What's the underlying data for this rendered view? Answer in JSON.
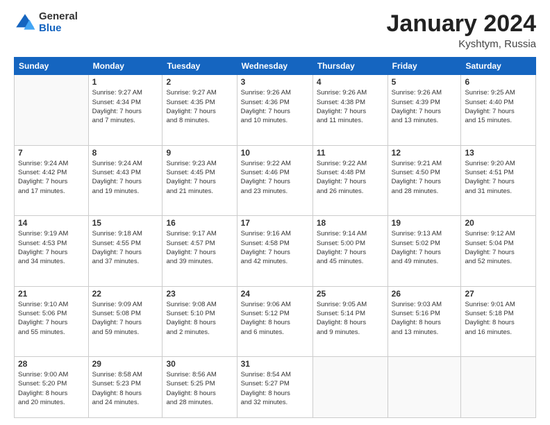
{
  "header": {
    "logo_general": "General",
    "logo_blue": "Blue",
    "title": "January 2024",
    "location": "Kyshtym, Russia"
  },
  "weekdays": [
    "Sunday",
    "Monday",
    "Tuesday",
    "Wednesday",
    "Thursday",
    "Friday",
    "Saturday"
  ],
  "weeks": [
    [
      {
        "day": "",
        "info": ""
      },
      {
        "day": "1",
        "info": "Sunrise: 9:27 AM\nSunset: 4:34 PM\nDaylight: 7 hours\nand 7 minutes."
      },
      {
        "day": "2",
        "info": "Sunrise: 9:27 AM\nSunset: 4:35 PM\nDaylight: 7 hours\nand 8 minutes."
      },
      {
        "day": "3",
        "info": "Sunrise: 9:26 AM\nSunset: 4:36 PM\nDaylight: 7 hours\nand 10 minutes."
      },
      {
        "day": "4",
        "info": "Sunrise: 9:26 AM\nSunset: 4:38 PM\nDaylight: 7 hours\nand 11 minutes."
      },
      {
        "day": "5",
        "info": "Sunrise: 9:26 AM\nSunset: 4:39 PM\nDaylight: 7 hours\nand 13 minutes."
      },
      {
        "day": "6",
        "info": "Sunrise: 9:25 AM\nSunset: 4:40 PM\nDaylight: 7 hours\nand 15 minutes."
      }
    ],
    [
      {
        "day": "7",
        "info": "Sunrise: 9:24 AM\nSunset: 4:42 PM\nDaylight: 7 hours\nand 17 minutes."
      },
      {
        "day": "8",
        "info": "Sunrise: 9:24 AM\nSunset: 4:43 PM\nDaylight: 7 hours\nand 19 minutes."
      },
      {
        "day": "9",
        "info": "Sunrise: 9:23 AM\nSunset: 4:45 PM\nDaylight: 7 hours\nand 21 minutes."
      },
      {
        "day": "10",
        "info": "Sunrise: 9:22 AM\nSunset: 4:46 PM\nDaylight: 7 hours\nand 23 minutes."
      },
      {
        "day": "11",
        "info": "Sunrise: 9:22 AM\nSunset: 4:48 PM\nDaylight: 7 hours\nand 26 minutes."
      },
      {
        "day": "12",
        "info": "Sunrise: 9:21 AM\nSunset: 4:50 PM\nDaylight: 7 hours\nand 28 minutes."
      },
      {
        "day": "13",
        "info": "Sunrise: 9:20 AM\nSunset: 4:51 PM\nDaylight: 7 hours\nand 31 minutes."
      }
    ],
    [
      {
        "day": "14",
        "info": "Sunrise: 9:19 AM\nSunset: 4:53 PM\nDaylight: 7 hours\nand 34 minutes."
      },
      {
        "day": "15",
        "info": "Sunrise: 9:18 AM\nSunset: 4:55 PM\nDaylight: 7 hours\nand 37 minutes."
      },
      {
        "day": "16",
        "info": "Sunrise: 9:17 AM\nSunset: 4:57 PM\nDaylight: 7 hours\nand 39 minutes."
      },
      {
        "day": "17",
        "info": "Sunrise: 9:16 AM\nSunset: 4:58 PM\nDaylight: 7 hours\nand 42 minutes."
      },
      {
        "day": "18",
        "info": "Sunrise: 9:14 AM\nSunset: 5:00 PM\nDaylight: 7 hours\nand 45 minutes."
      },
      {
        "day": "19",
        "info": "Sunrise: 9:13 AM\nSunset: 5:02 PM\nDaylight: 7 hours\nand 49 minutes."
      },
      {
        "day": "20",
        "info": "Sunrise: 9:12 AM\nSunset: 5:04 PM\nDaylight: 7 hours\nand 52 minutes."
      }
    ],
    [
      {
        "day": "21",
        "info": "Sunrise: 9:10 AM\nSunset: 5:06 PM\nDaylight: 7 hours\nand 55 minutes."
      },
      {
        "day": "22",
        "info": "Sunrise: 9:09 AM\nSunset: 5:08 PM\nDaylight: 7 hours\nand 59 minutes."
      },
      {
        "day": "23",
        "info": "Sunrise: 9:08 AM\nSunset: 5:10 PM\nDaylight: 8 hours\nand 2 minutes."
      },
      {
        "day": "24",
        "info": "Sunrise: 9:06 AM\nSunset: 5:12 PM\nDaylight: 8 hours\nand 6 minutes."
      },
      {
        "day": "25",
        "info": "Sunrise: 9:05 AM\nSunset: 5:14 PM\nDaylight: 8 hours\nand 9 minutes."
      },
      {
        "day": "26",
        "info": "Sunrise: 9:03 AM\nSunset: 5:16 PM\nDaylight: 8 hours\nand 13 minutes."
      },
      {
        "day": "27",
        "info": "Sunrise: 9:01 AM\nSunset: 5:18 PM\nDaylight: 8 hours\nand 16 minutes."
      }
    ],
    [
      {
        "day": "28",
        "info": "Sunrise: 9:00 AM\nSunset: 5:20 PM\nDaylight: 8 hours\nand 20 minutes."
      },
      {
        "day": "29",
        "info": "Sunrise: 8:58 AM\nSunset: 5:23 PM\nDaylight: 8 hours\nand 24 minutes."
      },
      {
        "day": "30",
        "info": "Sunrise: 8:56 AM\nSunset: 5:25 PM\nDaylight: 8 hours\nand 28 minutes."
      },
      {
        "day": "31",
        "info": "Sunrise: 8:54 AM\nSunset: 5:27 PM\nDaylight: 8 hours\nand 32 minutes."
      },
      {
        "day": "",
        "info": ""
      },
      {
        "day": "",
        "info": ""
      },
      {
        "day": "",
        "info": ""
      }
    ]
  ]
}
